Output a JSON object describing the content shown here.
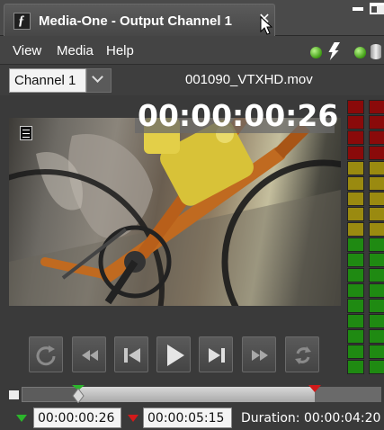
{
  "window": {
    "title": "Media-One - Output Channel 1",
    "app_icon": "media-one-logo-icon"
  },
  "menu": {
    "items": [
      "View",
      "Media",
      "Help"
    ]
  },
  "status": {
    "connected_color": "#3e9b12"
  },
  "channel": {
    "selected": "Channel 1",
    "filename": "001090_VTXHD.mov"
  },
  "video": {
    "timecode": "00:00:00:26"
  },
  "meters": {
    "colors": {
      "red": "#8a0a0a",
      "yellow": "#9a8a10",
      "green": "#1f8a12"
    }
  },
  "transport": {
    "buttons": [
      "loop-icon",
      "rewind-icon",
      "previous-icon",
      "play-icon",
      "next-icon",
      "fast-forward-icon",
      "sync-icon"
    ]
  },
  "timeline": {
    "in_fraction": 0.158,
    "out_fraction": 0.815
  },
  "footer": {
    "in_point": "00:00:00:26",
    "out_point": "00:00:05:15",
    "duration": "Duration: 00:00:04:20",
    "in_color": "#2bb52b",
    "out_color": "#d21a1a"
  }
}
